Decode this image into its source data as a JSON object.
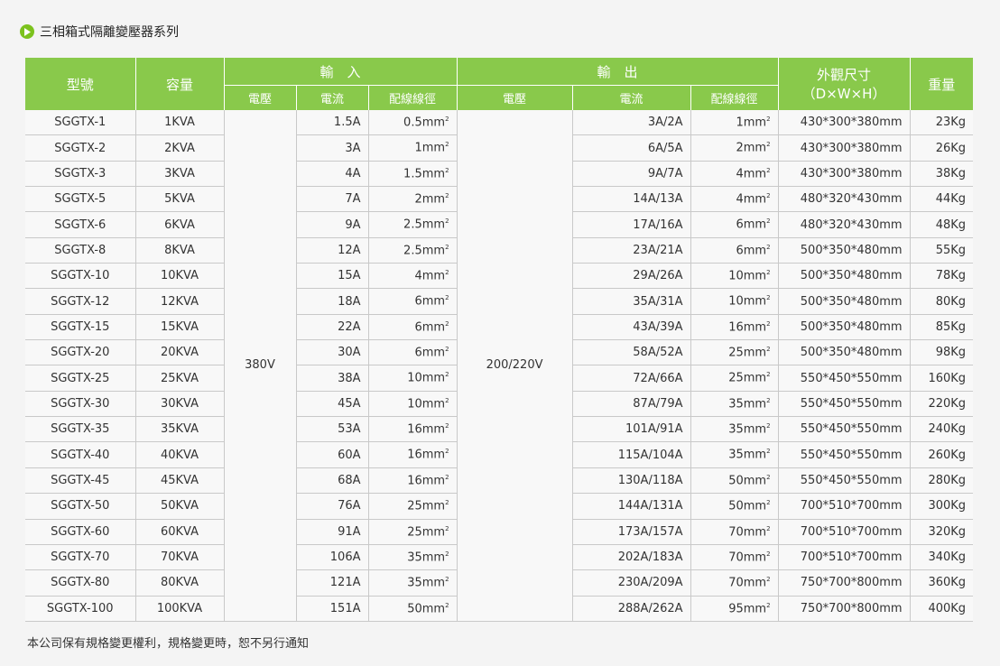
{
  "title": "三相箱式隔離變壓器系列",
  "headers": {
    "model": "型號",
    "capacity": "容量",
    "input": "輸　入",
    "output": "輸　出",
    "dimensions": "外觀尺寸",
    "dimensions_sub": "（D×W×H）",
    "weight": "重量",
    "in_voltage": "電壓",
    "in_current": "電流",
    "in_wire": "配線線徑",
    "out_voltage": "電壓",
    "out_current": "電流",
    "out_wire": "配線線徑"
  },
  "input_voltage": "380V",
  "output_voltage": "200/220V",
  "rows": [
    {
      "model": "SGGTX-1",
      "capacity": "1KVA",
      "in_current": "1.5A",
      "in_wire": "0.5mm",
      "out_current": "3A/2A",
      "out_wire": "1mm",
      "dims": "430*300*380mm",
      "weight": "23Kg"
    },
    {
      "model": "SGGTX-2",
      "capacity": "2KVA",
      "in_current": "3A",
      "in_wire": "1mm",
      "out_current": "6A/5A",
      "out_wire": "2mm",
      "dims": "430*300*380mm",
      "weight": "26Kg"
    },
    {
      "model": "SGGTX-3",
      "capacity": "3KVA",
      "in_current": "4A",
      "in_wire": "1.5mm",
      "out_current": "9A/7A",
      "out_wire": "4mm",
      "dims": "430*300*380mm",
      "weight": "38Kg"
    },
    {
      "model": "SGGTX-5",
      "capacity": "5KVA",
      "in_current": "7A",
      "in_wire": "2mm",
      "out_current": "14A/13A",
      "out_wire": "4mm",
      "dims": "480*320*430mm",
      "weight": "44Kg"
    },
    {
      "model": "SGGTX-6",
      "capacity": "6KVA",
      "in_current": "9A",
      "in_wire": "2.5mm",
      "out_current": "17A/16A",
      "out_wire": "6mm",
      "dims": "480*320*430mm",
      "weight": "48Kg"
    },
    {
      "model": "SGGTX-8",
      "capacity": "8KVA",
      "in_current": "12A",
      "in_wire": "2.5mm",
      "out_current": "23A/21A",
      "out_wire": "6mm",
      "dims": "500*350*480mm",
      "weight": "55Kg"
    },
    {
      "model": "SGGTX-10",
      "capacity": "10KVA",
      "in_current": "15A",
      "in_wire": "4mm",
      "out_current": "29A/26A",
      "out_wire": "10mm",
      "dims": "500*350*480mm",
      "weight": "78Kg"
    },
    {
      "model": "SGGTX-12",
      "capacity": "12KVA",
      "in_current": "18A",
      "in_wire": "6mm",
      "out_current": "35A/31A",
      "out_wire": "10mm",
      "dims": "500*350*480mm",
      "weight": "80Kg"
    },
    {
      "model": "SGGTX-15",
      "capacity": "15KVA",
      "in_current": "22A",
      "in_wire": "6mm",
      "out_current": "43A/39A",
      "out_wire": "16mm",
      "dims": "500*350*480mm",
      "weight": "85Kg"
    },
    {
      "model": "SGGTX-20",
      "capacity": "20KVA",
      "in_current": "30A",
      "in_wire": "6mm",
      "out_current": "58A/52A",
      "out_wire": "25mm",
      "dims": "500*350*480mm",
      "weight": "98Kg"
    },
    {
      "model": "SGGTX-25",
      "capacity": "25KVA",
      "in_current": "38A",
      "in_wire": "10mm",
      "out_current": "72A/66A",
      "out_wire": "25mm",
      "dims": "550*450*550mm",
      "weight": "160Kg"
    },
    {
      "model": "SGGTX-30",
      "capacity": "30KVA",
      "in_current": "45A",
      "in_wire": "10mm",
      "out_current": "87A/79A",
      "out_wire": "35mm",
      "dims": "550*450*550mm",
      "weight": "220Kg"
    },
    {
      "model": "SGGTX-35",
      "capacity": "35KVA",
      "in_current": "53A",
      "in_wire": "16mm",
      "out_current": "101A/91A",
      "out_wire": "35mm",
      "dims": "550*450*550mm",
      "weight": "240Kg"
    },
    {
      "model": "SGGTX-40",
      "capacity": "40KVA",
      "in_current": "60A",
      "in_wire": "16mm",
      "out_current": "115A/104A",
      "out_wire": "35mm",
      "dims": "550*450*550mm",
      "weight": "260Kg"
    },
    {
      "model": "SGGTX-45",
      "capacity": "45KVA",
      "in_current": "68A",
      "in_wire": "16mm",
      "out_current": "130A/118A",
      "out_wire": "50mm",
      "dims": "550*450*550mm",
      "weight": "280Kg"
    },
    {
      "model": "SGGTX-50",
      "capacity": "50KVA",
      "in_current": "76A",
      "in_wire": "25mm",
      "out_current": "144A/131A",
      "out_wire": "50mm",
      "dims": "700*510*700mm",
      "weight": "300Kg"
    },
    {
      "model": "SGGTX-60",
      "capacity": "60KVA",
      "in_current": "91A",
      "in_wire": "25mm",
      "out_current": "173A/157A",
      "out_wire": "70mm",
      "dims": "700*510*700mm",
      "weight": "320Kg"
    },
    {
      "model": "SGGTX-70",
      "capacity": "70KVA",
      "in_current": "106A",
      "in_wire": "35mm",
      "out_current": "202A/183A",
      "out_wire": "70mm",
      "dims": "700*510*700mm",
      "weight": "340Kg"
    },
    {
      "model": "SGGTX-80",
      "capacity": "80KVA",
      "in_current": "121A",
      "in_wire": "35mm",
      "out_current": "230A/209A",
      "out_wire": "70mm",
      "dims": "750*700*800mm",
      "weight": "360Kg"
    },
    {
      "model": "SGGTX-100",
      "capacity": "100KVA",
      "in_current": "151A",
      "in_wire": "50mm",
      "out_current": "288A/262A",
      "out_wire": "95mm",
      "dims": "750*700*800mm",
      "weight": "400Kg"
    }
  ],
  "superscript": "2",
  "note": "本公司保有規格變更權利，規格變更時，恕不另行通知",
  "colors": {
    "header_green": "#89c94b",
    "icon_green": "#7cc21e"
  }
}
